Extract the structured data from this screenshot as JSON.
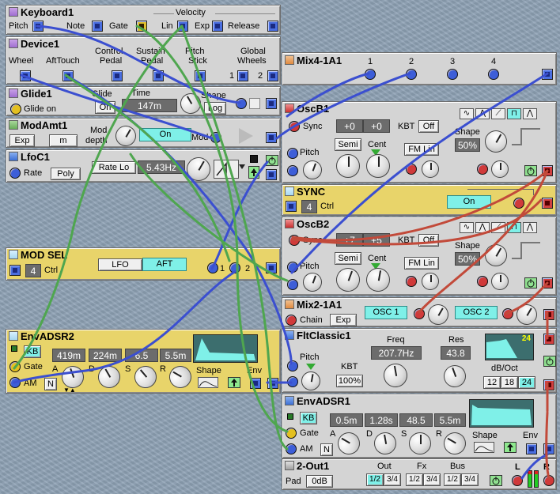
{
  "keyboard": {
    "title": "Keyboard1",
    "velocity": "Velocity",
    "pitch": "Pitch",
    "note": "Note",
    "gate": "Gate",
    "lin": "Lin",
    "exp": "Exp",
    "release": "Release"
  },
  "device": {
    "title": "Device1",
    "wheel": "Wheel",
    "afttouch": "AftTouch",
    "control": "Control",
    "pedal": "Pedal",
    "sustain": "Sustain",
    "sustain_pedal": "Pedal",
    "pitch": "Pitch",
    "stick": "Stick",
    "global": "Global",
    "wheels": "Wheels",
    "w1": "1",
    "w2": "2"
  },
  "mix4": {
    "title": "Mix4-1A1",
    "ch1": "1",
    "ch2": "2",
    "ch3": "3",
    "ch4": "4"
  },
  "glide": {
    "title": "Glide1",
    "glide_on": "Glide on",
    "glide": "Glide",
    "time": "Time",
    "time_val": "147m",
    "shape": "Shape",
    "shape_val": "Log",
    "mode": "On"
  },
  "modamt": {
    "title": "ModAmt1",
    "exp": "Exp",
    "m": "m",
    "mod": "Mod",
    "depth": "depth",
    "on": "On",
    "mod2": "Mod"
  },
  "lfo": {
    "title": "LfoC1",
    "rate": "Rate",
    "poly": "Poly",
    "rate_lo": "Rate Lo",
    "freq": "5.43Hz"
  },
  "osc1": {
    "title": "OscB1",
    "sync": "Sync",
    "coarse": "+0",
    "fine": "+0",
    "kbt": "KBT",
    "kbt_val": "Off",
    "pitch": "Pitch",
    "semi": "Semi",
    "cent": "Cent",
    "fm_lin": "FM Lin",
    "shape": "Shape",
    "shape_val": "50%"
  },
  "sync": {
    "title": "SYNC",
    "ctrl": "Ctrl",
    "val": "4",
    "on": "On"
  },
  "osc2": {
    "title": "OscB2",
    "sync": "Sync",
    "coarse": "+7",
    "fine": "+5",
    "kbt": "KBT",
    "kbt_val": "Off",
    "pitch": "Pitch",
    "semi": "Semi",
    "cent": "Cent",
    "fm_lin": "FM Lin",
    "shape": "Shape",
    "shape_val": "50%"
  },
  "modsel": {
    "title": "MOD SEL",
    "ctrl": "Ctrl",
    "val": "4",
    "lfo": "LFO",
    "aft": "AFT",
    "n1": "1",
    "n2": "2"
  },
  "mix2": {
    "title": "Mix2-1A1",
    "chain": "Chain",
    "exp": "Exp",
    "osc1": "OSC 1",
    "osc2": "OSC 2"
  },
  "env2": {
    "title": "EnvADSR2",
    "kb": "KB",
    "gate": "Gate",
    "am": "AM",
    "n": "N",
    "a": "419m",
    "d": "224m",
    "s": "6.5",
    "r": "5.5m",
    "la": "A",
    "ld": "D",
    "ls": "S",
    "lr": "R",
    "shape": "Shape",
    "env": "Env"
  },
  "flt": {
    "title": "FltClassic1",
    "pitch": "Pitch",
    "kbt": "KBT",
    "kbt_val": "100%",
    "freq": "Freq",
    "freq_val": "207.7Hz",
    "res": "Res",
    "res_val": "43.8",
    "db": "dB/Oct",
    "d12": "12",
    "d18": "18",
    "d24": "24",
    "screen_val": "24"
  },
  "env1": {
    "title": "EnvADSR1",
    "kb": "KB",
    "gate": "Gate",
    "am": "AM",
    "n": "N",
    "a": "0.5m",
    "d": "1.28s",
    "s": "48.5",
    "r": "5.5m",
    "la": "A",
    "ld": "D",
    "ls": "S",
    "lr": "R",
    "shape": "Shape",
    "env": "Env"
  },
  "out": {
    "title": "2-Out1",
    "pad": "Pad",
    "pad_val": "0dB",
    "out": "Out",
    "fx": "Fx",
    "bus": "Bus",
    "o1": "1/2",
    "o2": "3/4",
    "f1": "1/2",
    "f2": "3/4",
    "b1": "1/2",
    "b2": "3/4",
    "l": "L",
    "r": "R"
  }
}
